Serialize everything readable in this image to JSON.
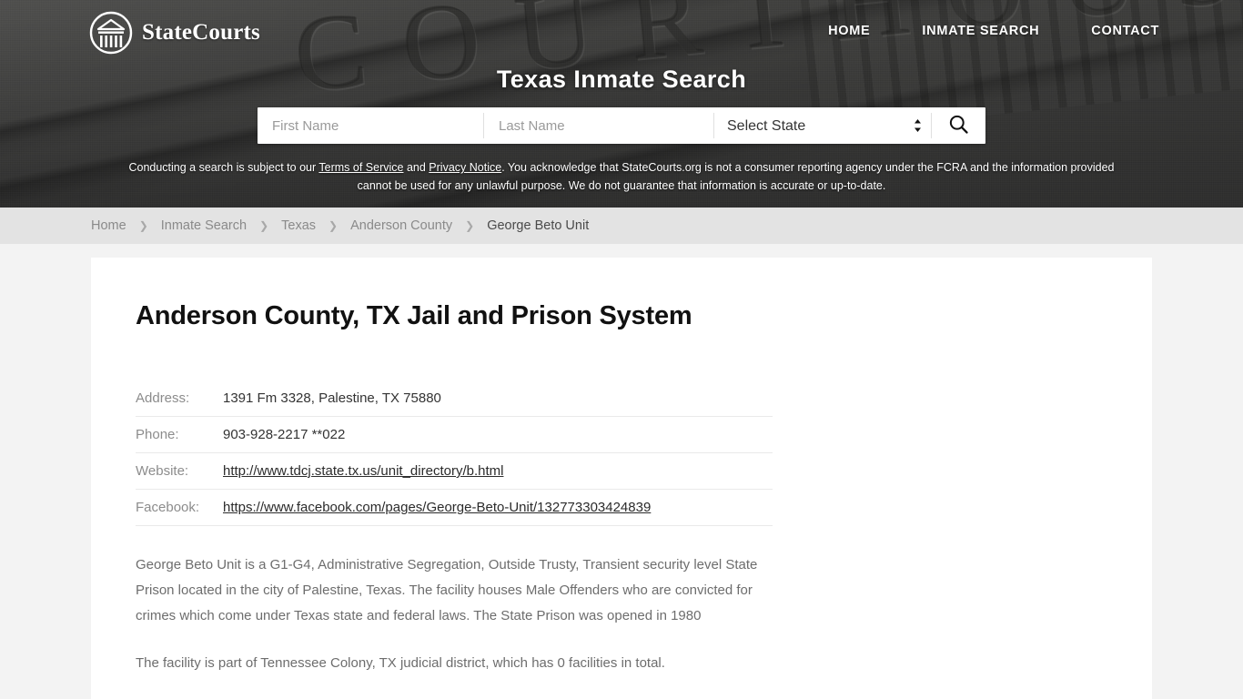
{
  "header": {
    "brand_name": "StateCourts",
    "brand_icon": "courthouse-logo-icon",
    "nav": [
      {
        "label": "HOME"
      },
      {
        "label": "INMATE SEARCH"
      },
      {
        "label": "CONTACT"
      }
    ],
    "hero_title": "Texas Inmate Search",
    "background_engraving": "COURTHOUSE"
  },
  "search": {
    "first_name_placeholder": "First Name",
    "first_name_value": "",
    "last_name_placeholder": "Last Name",
    "last_name_value": "",
    "state_selected": "Select State",
    "state_options": [
      "Select State"
    ],
    "search_icon": "magnifier-icon",
    "stepper_icon": "up-down-stepper-icon"
  },
  "disclaimer": {
    "part1": "Conducting a search is subject to our ",
    "link1": "Terms of Service",
    "part2": " and ",
    "link2": "Privacy Notice",
    "part3": ". You acknowledge that StateCourts.org is not a consumer reporting agency under the FCRA and the information provided cannot be used for any unlawful purpose. We do not guarantee that information is accurate or up-to-date."
  },
  "breadcrumb": {
    "separator": "❯",
    "items": [
      {
        "label": "Home"
      },
      {
        "label": "Inmate Search"
      },
      {
        "label": "Texas"
      },
      {
        "label": "Anderson County"
      },
      {
        "label": "George Beto Unit"
      }
    ]
  },
  "main": {
    "page_title": "Anderson County, TX Jail and Prison System",
    "details": [
      {
        "label": "Address:",
        "value": "1391 Fm 3328, Palestine, TX 75880",
        "is_link": false
      },
      {
        "label": "Phone:",
        "value": "903-928-2217 **022",
        "is_link": false
      },
      {
        "label": "Website:",
        "value": "http://www.tdcj.state.tx.us/unit_directory/b.html",
        "is_link": true
      },
      {
        "label": "Facebook:",
        "value": "https://www.facebook.com/pages/George-Beto-Unit/132773303424839",
        "is_link": true
      }
    ],
    "paragraphs": [
      "George Beto Unit is a G1-G4, Administrative Segregation, Outside Trusty, Transient security level State Prison located in the city of Palestine, Texas. The facility houses Male Offenders who are convicted for crimes which come under Texas state and federal laws. The State Prison was opened in 1980",
      "The facility is part of Tennessee Colony, TX judicial district, which has 0 facilities in total."
    ]
  },
  "colors": {
    "page_background": "#f3f3f3",
    "card_background": "#ffffff",
    "breadcrumb_background": "#e3e3e3",
    "hero_overlay": "#2a2a2a",
    "label_gray": "#8c8c8c",
    "value_dark": "#333333",
    "body_gray": "#6d6d6d"
  }
}
